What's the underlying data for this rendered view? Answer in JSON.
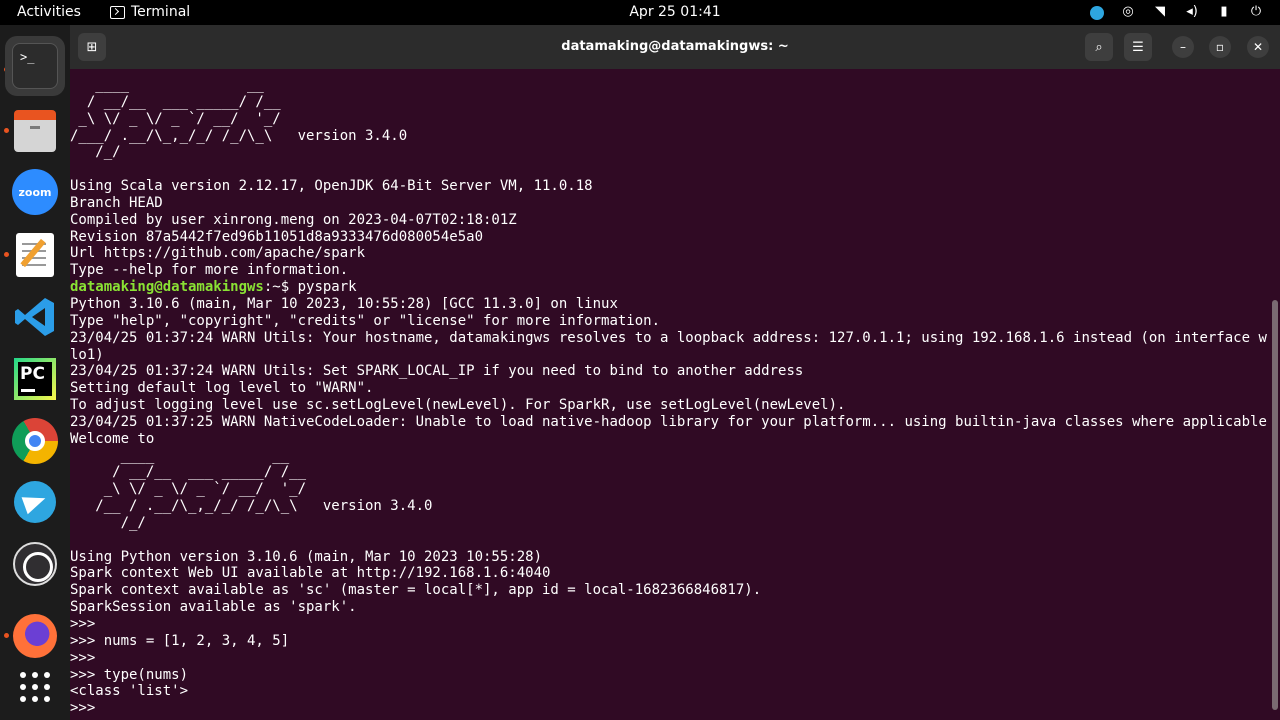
{
  "topbar": {
    "activities": "Activities",
    "app_name": "Terminal",
    "clock": "Apr 25  01:41"
  },
  "dock": {
    "items": [
      "terminal",
      "files",
      "zoom",
      "text-editor",
      "vscode",
      "pycharm",
      "chrome",
      "telegram",
      "obs",
      "firefox",
      "show-apps"
    ],
    "zoom_label": "zoom",
    "pycharm_label": "PC",
    "terminal_label": ">_"
  },
  "window": {
    "title": "datamaking@datamakingws: ~"
  },
  "terminal": {
    "lines": [
      "   ____              __",
      "  / __/__  ___ _____/ /__",
      " _\\ \\/ _ \\/ _ `/ __/  '_/",
      "/___/ .__/\\_,_/_/ /_/\\_\\   version 3.4.0",
      "   /_/",
      "",
      "Using Scala version 2.12.17, OpenJDK 64-Bit Server VM, 11.0.18",
      "Branch HEAD",
      "Compiled by user xinrong.meng on 2023-04-07T02:18:01Z",
      "Revision 87a5442f7ed96b11051d8a9333476d080054e5a0",
      "Url https://github.com/apache/spark",
      "Type --help for more information."
    ],
    "prompt_user": "datamaking@datamakingws",
    "prompt_rest": ":~$ ",
    "prompt_command": "pyspark",
    "lines2": [
      "Python 3.10.6 (main, Mar 10 2023, 10:55:28) [GCC 11.3.0] on linux",
      "Type \"help\", \"copyright\", \"credits\" or \"license\" for more information.",
      "23/04/25 01:37:24 WARN Utils: Your hostname, datamakingws resolves to a loopback address: 127.0.1.1; using 192.168.1.6 instead (on interface w",
      "lo1)",
      "23/04/25 01:37:24 WARN Utils: Set SPARK_LOCAL_IP if you need to bind to another address",
      "Setting default log level to \"WARN\".",
      "To adjust logging level use sc.setLogLevel(newLevel). For SparkR, use setLogLevel(newLevel).",
      "23/04/25 01:37:25 WARN NativeCodeLoader: Unable to load native-hadoop library for your platform... using builtin-java classes where applicable",
      "Welcome to",
      "      ____              __",
      "     / __/__  ___ _____/ /__",
      "    _\\ \\/ _ \\/ _ `/ __/  '_/",
      "   /__ / .__/\\_,_/_/ /_/\\_\\   version 3.4.0",
      "      /_/",
      "",
      "Using Python version 3.10.6 (main, Mar 10 2023 10:55:28)",
      "Spark context Web UI available at http://192.168.1.6:4040",
      "Spark context available as 'sc' (master = local[*], app id = local-1682366846817).",
      "SparkSession available as 'spark'.",
      ">>>",
      ">>> nums = [1, 2, 3, 4, 5]",
      ">>>",
      ">>> type(nums)",
      "<class 'list'>"
    ],
    "last_prompt": ">>> "
  }
}
